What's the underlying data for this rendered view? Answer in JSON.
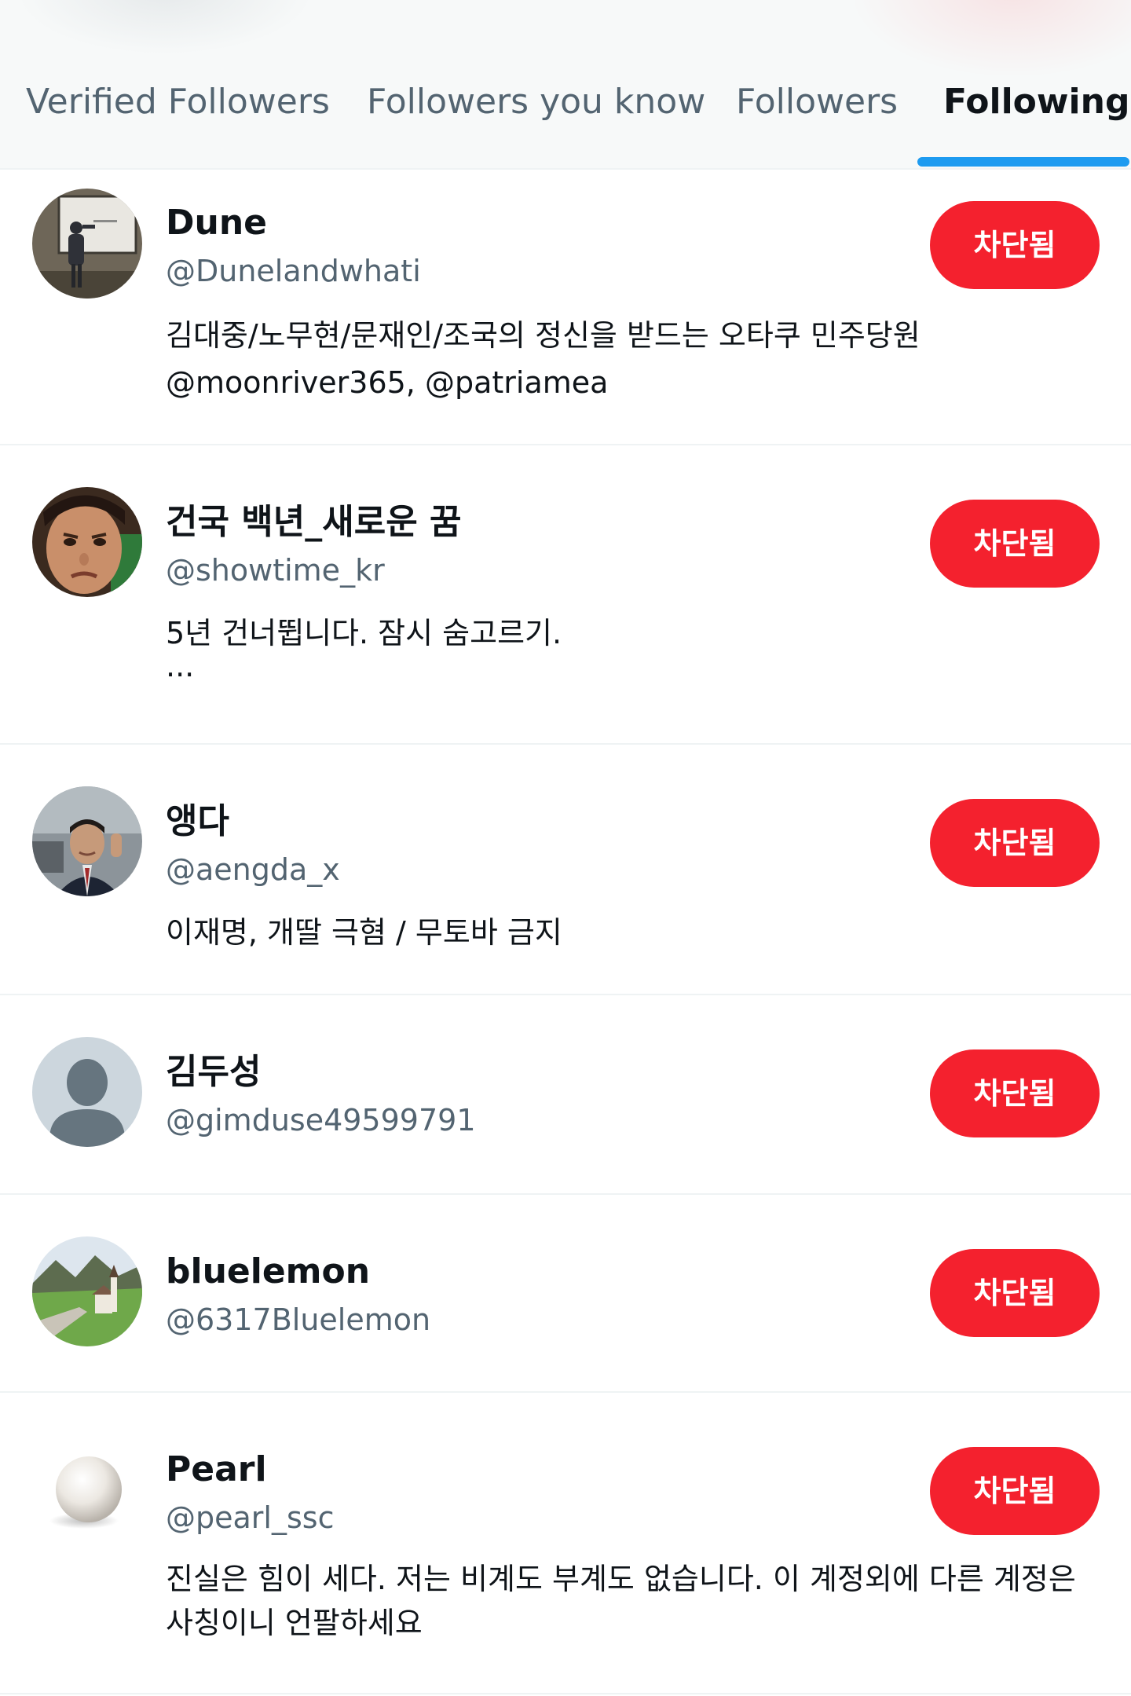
{
  "tabs": [
    {
      "label": "Verified Followers",
      "active": false
    },
    {
      "label": "Followers you know",
      "active": false
    },
    {
      "label": "Followers",
      "active": false
    },
    {
      "label": "Following",
      "active": true
    }
  ],
  "colors": {
    "accent": "#1d9bf0",
    "blocked_button": "#f4212e",
    "secondary_text": "#536471",
    "primary_text": "#0f1419",
    "divider": "#eff3f4"
  },
  "users": [
    {
      "display_name": "Dune",
      "handle": "@Dunelandwhati",
      "bio": [
        "김대중/노무현/문재인/조국의 정신을 받드는 오타쿠 민주당원",
        "@moonriver365, @patriamea"
      ],
      "button_label": "차단됨",
      "avatar_icon": "presenter-photo-avatar"
    },
    {
      "display_name": "건국 백년_새로운 꿈",
      "handle": "@showtime_kr",
      "bio": [
        "5년 건너뜁니다. 잠시 숨고르기.",
        "..."
      ],
      "button_label": "차단됨",
      "avatar_icon": "child-face-photo-avatar"
    },
    {
      "display_name": "앵다",
      "handle": "@aengda_x",
      "bio": [
        "이재명, 개딸 극혐 / 무토바 금지"
      ],
      "button_label": "차단됨",
      "avatar_icon": "man-in-suit-photo-avatar"
    },
    {
      "display_name": "김두성",
      "handle": "@gimduse49599791",
      "bio": [],
      "button_label": "차단됨",
      "avatar_icon": "default-profile-avatar"
    },
    {
      "display_name": "bluelemon",
      "handle": "@6317Bluelemon",
      "bio": [],
      "button_label": "차단됨",
      "avatar_icon": "landscape-church-photo-avatar"
    },
    {
      "display_name": "Pearl",
      "handle": "@pearl_ssc",
      "bio": [
        "진실은 힘이 세다. 저는 비계도 부계도 없습니다. 이 계정외에 다른 계정은",
        "사칭이니 언팔하세요"
      ],
      "button_label": "차단됨",
      "avatar_icon": "pearl-photo-avatar"
    }
  ]
}
